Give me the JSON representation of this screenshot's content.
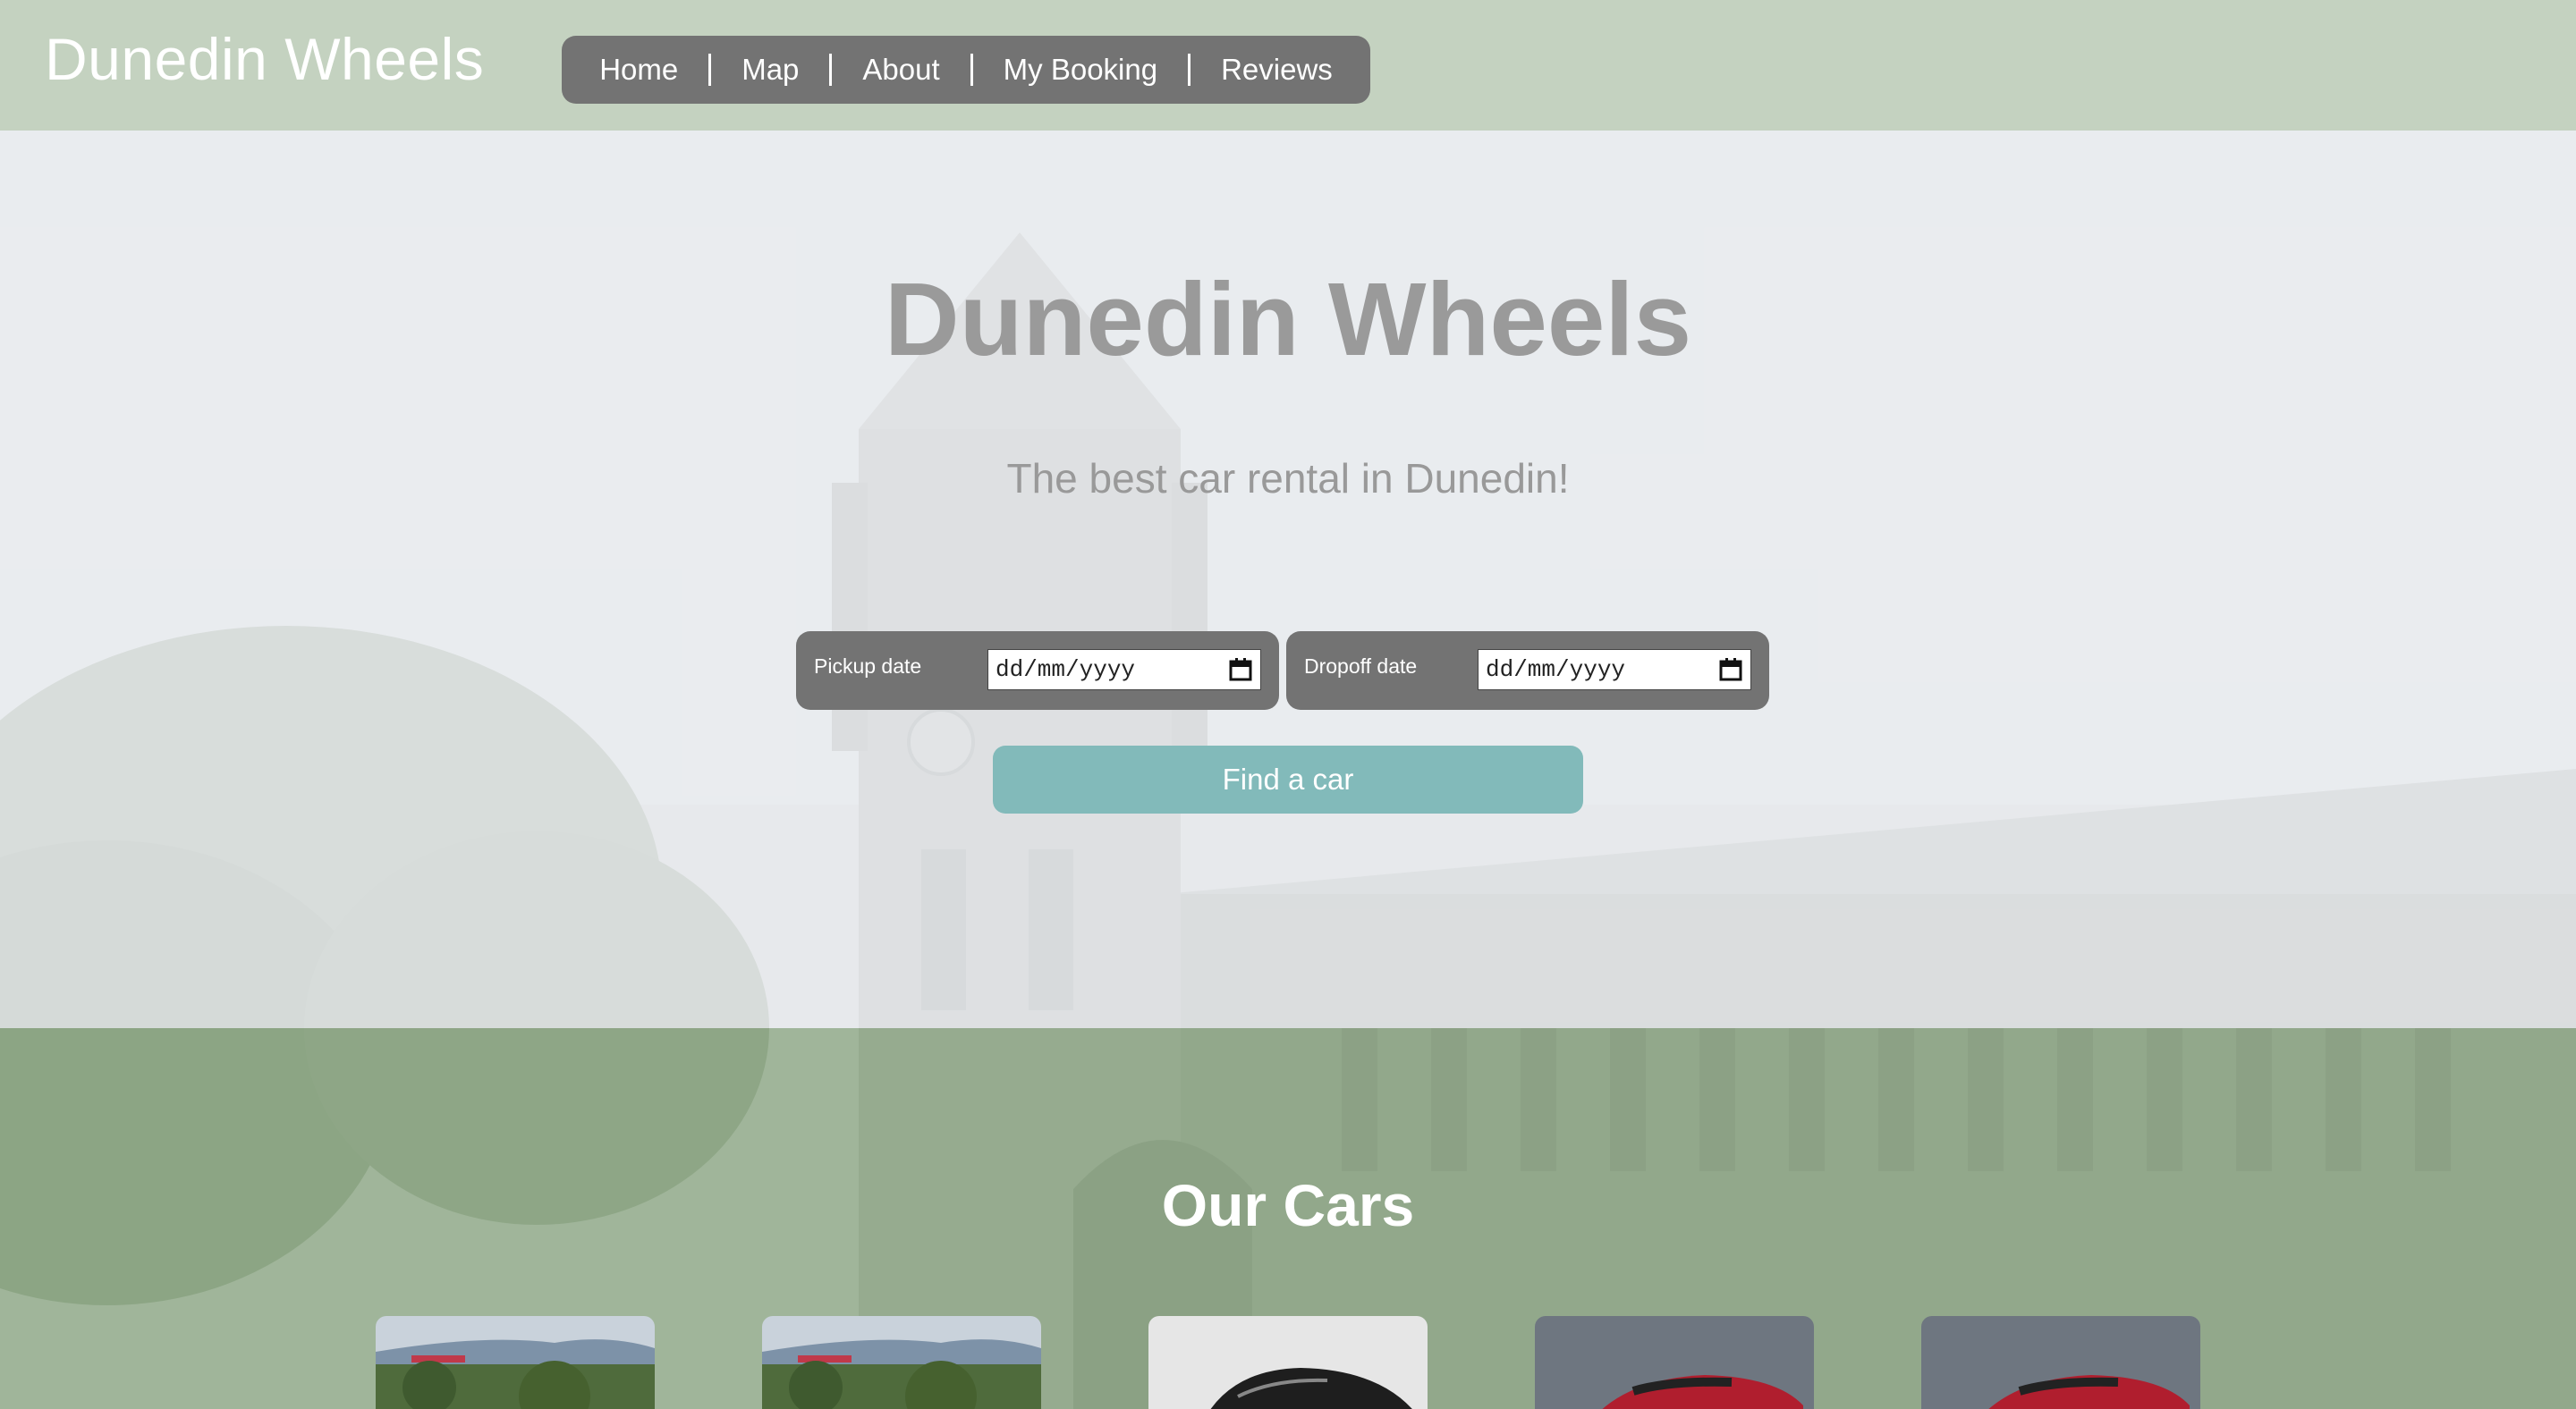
{
  "header": {
    "brand": "Dunedin Wheels",
    "nav": [
      "Home",
      "Map",
      "About",
      "My Booking",
      "Reviews"
    ]
  },
  "hero": {
    "title": "Dunedin Wheels",
    "subtitle": "The best car rental in Dunedin!",
    "pickup": {
      "label": "Pickup date",
      "placeholder": "dd/mm/yyyy"
    },
    "dropoff": {
      "label": "Dropoff date",
      "placeholder": "dd/mm/yyyy"
    },
    "find_button": "Find a car"
  },
  "cars": {
    "title": "Our Cars",
    "cards": [
      {
        "image": "landscape-photo"
      },
      {
        "image": "landscape-photo"
      },
      {
        "image": "dark-car-photo"
      },
      {
        "image": "red-car-photo"
      },
      {
        "image": "red-car-photo"
      }
    ]
  },
  "colors": {
    "header_bg": "#c4d2c0",
    "nav_bg": "#737373",
    "button_bg": "#82baba",
    "section_green": "#94ae8c"
  }
}
